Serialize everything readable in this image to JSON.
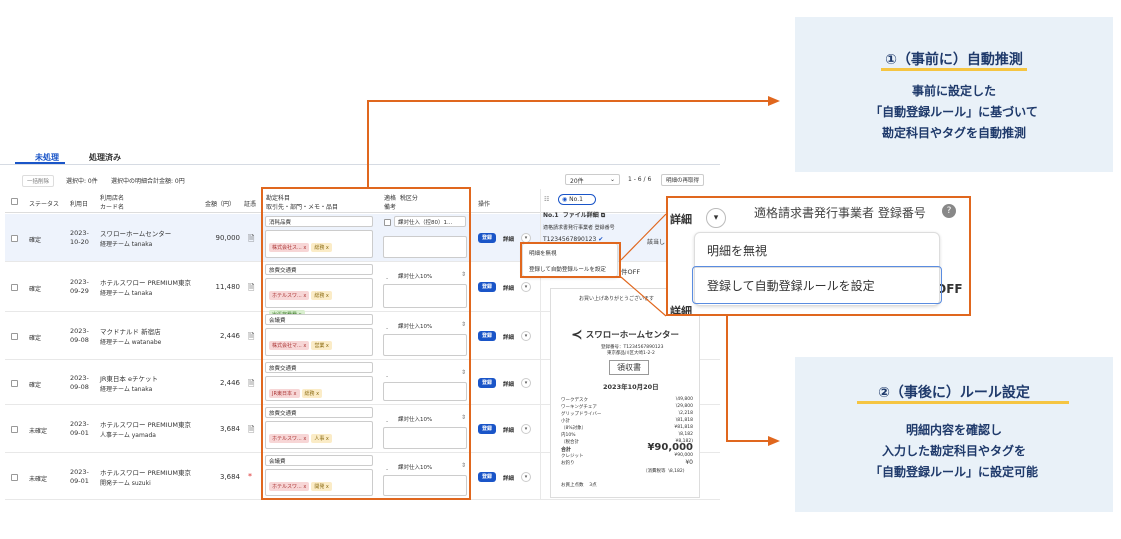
{
  "tabs": [
    {
      "label": "未処理"
    },
    {
      "label": "処理済み"
    }
  ],
  "toolbar": {
    "bulk": "一括削除",
    "selected": "選択中: 0件",
    "selected_total": "選択中の明細合計金額: 0円",
    "per_page": "20件",
    "range": "1 - 6 / 6",
    "refetch": "明細の再取得"
  },
  "headers": {
    "status": "ステータス",
    "date": "利用日",
    "store_line1": "利用店名",
    "store_line2": "カード名",
    "amount": "金額（円）",
    "receipt": "証憑",
    "account_line1": "勘定科目",
    "account_line2": "取引先・部門・メモ・品目",
    "tax_line1": "適格",
    "tax_line1b": "税区分",
    "tax_line2": "備考",
    "action": "操作"
  },
  "rows": [
    {
      "status": "確定",
      "date1": "2023-",
      "date2": "10-20",
      "store": "スワローホームセンター",
      "team": "経理チーム tanaka",
      "amount": "90,000",
      "account": "消耗品費",
      "tags": [
        {
          "t": "株式会社ス... x",
          "c": "pink"
        },
        {
          "t": "総務 x",
          "c": "yel"
        }
      ],
      "tax": "課対仕入（控80）1...",
      "has_cb": true
    },
    {
      "status": "確定",
      "date1": "2023-",
      "date2": "09-29",
      "store": "ホテルスワロー PREMIUM東京",
      "team": "経理チーム tanaka",
      "amount": "11,480",
      "account": "旅費交通費",
      "tags": [
        {
          "t": "ホテルスワ... x",
          "c": "pink"
        },
        {
          "t": "総務 x",
          "c": "yel"
        },
        {
          "t": "出張旅費費 x",
          "c": "grn"
        }
      ],
      "tax": "課対仕入10%",
      "has_cb": false
    },
    {
      "status": "確定",
      "date1": "2023-",
      "date2": "09-08",
      "store": "マクドナルド 新宿店",
      "team": "経理チーム watanabe",
      "amount": "2,446",
      "account": "会議費",
      "tags": [
        {
          "t": "株式会社マ... x",
          "c": "pink"
        },
        {
          "t": "営業 x",
          "c": "yel"
        }
      ],
      "tax": "課対仕入10%",
      "has_cb": false
    },
    {
      "status": "確定",
      "date1": "2023-",
      "date2": "09-08",
      "store": "JR東日本 eチケット",
      "team": "経理チーム tanaka",
      "amount": "2,446",
      "account": "旅費交通費",
      "tags": [
        {
          "t": "JR東日本 x",
          "c": "pink"
        },
        {
          "t": "総務 x",
          "c": "yel"
        }
      ],
      "tax": "",
      "has_cb": false
    },
    {
      "status": "未確定",
      "date1": "2023-",
      "date2": "09-01",
      "store": "ホテルスワロー PREMIUM東京",
      "team": "人事チーム yamada",
      "amount": "3,684",
      "account": "旅費交通費",
      "tags": [
        {
          "t": "ホテルスワ... x",
          "c": "pink"
        },
        {
          "t": "人事 x",
          "c": "yel"
        }
      ],
      "tax": "課対仕入10%",
      "has_cb": false
    },
    {
      "status": "未確定",
      "date1": "2023-",
      "date2": "09-01",
      "store": "ホテルスワロー PREMIUM東京",
      "team": "開発チーム suzuki",
      "amount": "3,684",
      "account": "会議費",
      "tags": [
        {
          "t": "ホテルスワ... x",
          "c": "pink"
        },
        {
          "t": "開発 x",
          "c": "yel"
        }
      ],
      "tax": "課対仕入10%",
      "has_cb": false
    }
  ],
  "row_buttons": {
    "register": "登録",
    "detail": "詳細",
    "more": "▾"
  },
  "panel": {
    "radio_label": "No.1",
    "title": "No.1",
    "file_detail": "ファイル詳細",
    "invoice_label": "適格請求書発行事業者 登録番号",
    "invoice_no": "T1234567890123",
    "apply": "該当し",
    "off_label": "件OFF",
    "thanks": "お買い上げありがとうございます",
    "shop": "スワローホームセンター",
    "reg_no": "登録番号：T1234567890123",
    "address": "東京都品川区大崎1-2-2",
    "receipt_title": "領収書",
    "receipt_date": "2023年10月20日",
    "items": [
      {
        "n": "ワークデスク",
        "v": "\\49,800"
      },
      {
        "n": "ワーキングチェア",
        "v": "\\29,800"
      },
      {
        "n": "グリップドライバー",
        "v": "\\2,218"
      },
      {
        "n": "小計",
        "v": "\\81,818"
      },
      {
        "n": "（8%対象）",
        "v": "¥81,818"
      },
      {
        "n": "内10%",
        "v": "\\8,182"
      },
      {
        "n": "（税合計",
        "v": "¥8,182)"
      }
    ],
    "total_label": "合計",
    "total": "¥90,000",
    "credit_label": "クレジット",
    "credit": "¥90,000",
    "change_label": "お釣り",
    "change": "¥0",
    "tax_note": "（消費税等",
    "tax_val": "\\8,182)",
    "count_label": "お買上点数",
    "count": "3点"
  },
  "small_menu": {
    "ignore": "明細を無視",
    "register_rule": "登録して自動登録ルールを設定"
  },
  "zoom": {
    "header_text": "適格請求書発行事業者 登録番号",
    "detail": "詳細",
    "ignore": "明細を無視",
    "register_rule": "登録して自動登録ルールを設定",
    "off_label": "OFF"
  },
  "callout1": {
    "title": "①（事前に）自動推測",
    "body": [
      "事前に設定した",
      "「自動登録ルール」に基づいて",
      "勘定科目やタグを自動推測"
    ]
  },
  "callout2": {
    "title": "②（事後に）ルール設定",
    "body": [
      "明細内容を確認し",
      "入力した勘定科目やタグを",
      "「自動登録ルール」に設定可能"
    ]
  },
  "colors": {
    "accent": "#1a55c8",
    "orange": "#e0671e",
    "callout_bg": "#e9f1f8",
    "navy": "#1f3a6b"
  }
}
